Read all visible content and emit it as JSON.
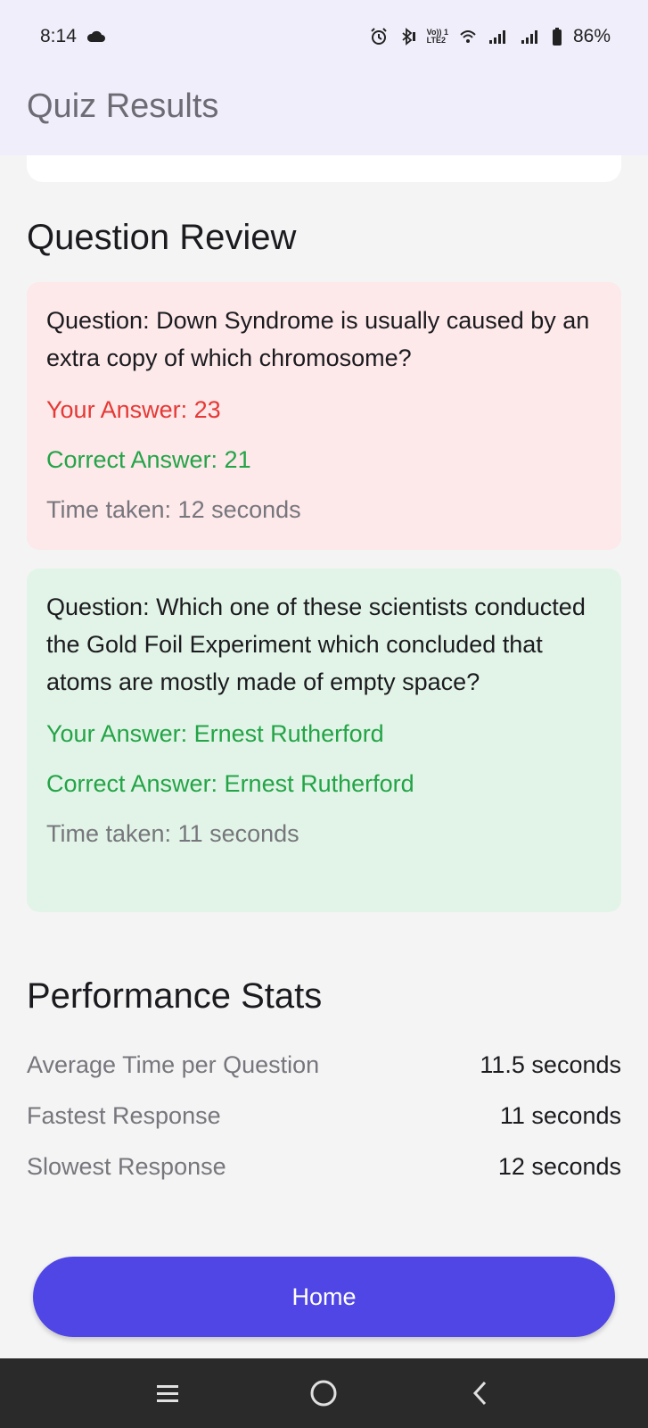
{
  "status_bar": {
    "time": "8:14",
    "volte_top": "Vo)) 1",
    "volte_bottom": "LTE2",
    "battery": "86%"
  },
  "app_bar": {
    "title": "Quiz Results"
  },
  "question_review": {
    "heading": "Question Review",
    "items": [
      {
        "question": "Question: Down Syndrome is usually caused by an extra copy of which chromosome?",
        "your_answer": "Your Answer: 23",
        "correct_answer": "Correct Answer: 21",
        "time_taken": "Time taken: 12 seconds",
        "is_correct": false
      },
      {
        "question": "Question: Which one of these scientists conducted the Gold Foil Experiment which concluded that atoms are mostly made of empty space?",
        "your_answer": "Your Answer: Ernest Rutherford",
        "correct_answer": "Correct Answer: Ernest Rutherford",
        "time_taken": "Time taken: 11 seconds",
        "is_correct": true
      }
    ]
  },
  "performance_stats": {
    "heading": "Performance Stats",
    "rows": [
      {
        "label": "Average Time per Question",
        "value": "11.5 seconds"
      },
      {
        "label": "Fastest Response",
        "value": "11 seconds"
      },
      {
        "label": "Slowest Response",
        "value": "12 seconds"
      }
    ]
  },
  "home_button": {
    "label": "Home"
  },
  "colors": {
    "accent": "#4f46e5",
    "wrong": "#e53935",
    "correct": "#23a447",
    "wrong_bg": "#fde8ea",
    "correct_bg": "#e2f4e7"
  },
  "icons": [
    "cloud-icon",
    "alarm-icon",
    "bluetooth-icon",
    "wifi-icon",
    "signal-icon",
    "battery-icon",
    "recent-apps-icon",
    "home-circle-icon",
    "back-icon"
  ]
}
